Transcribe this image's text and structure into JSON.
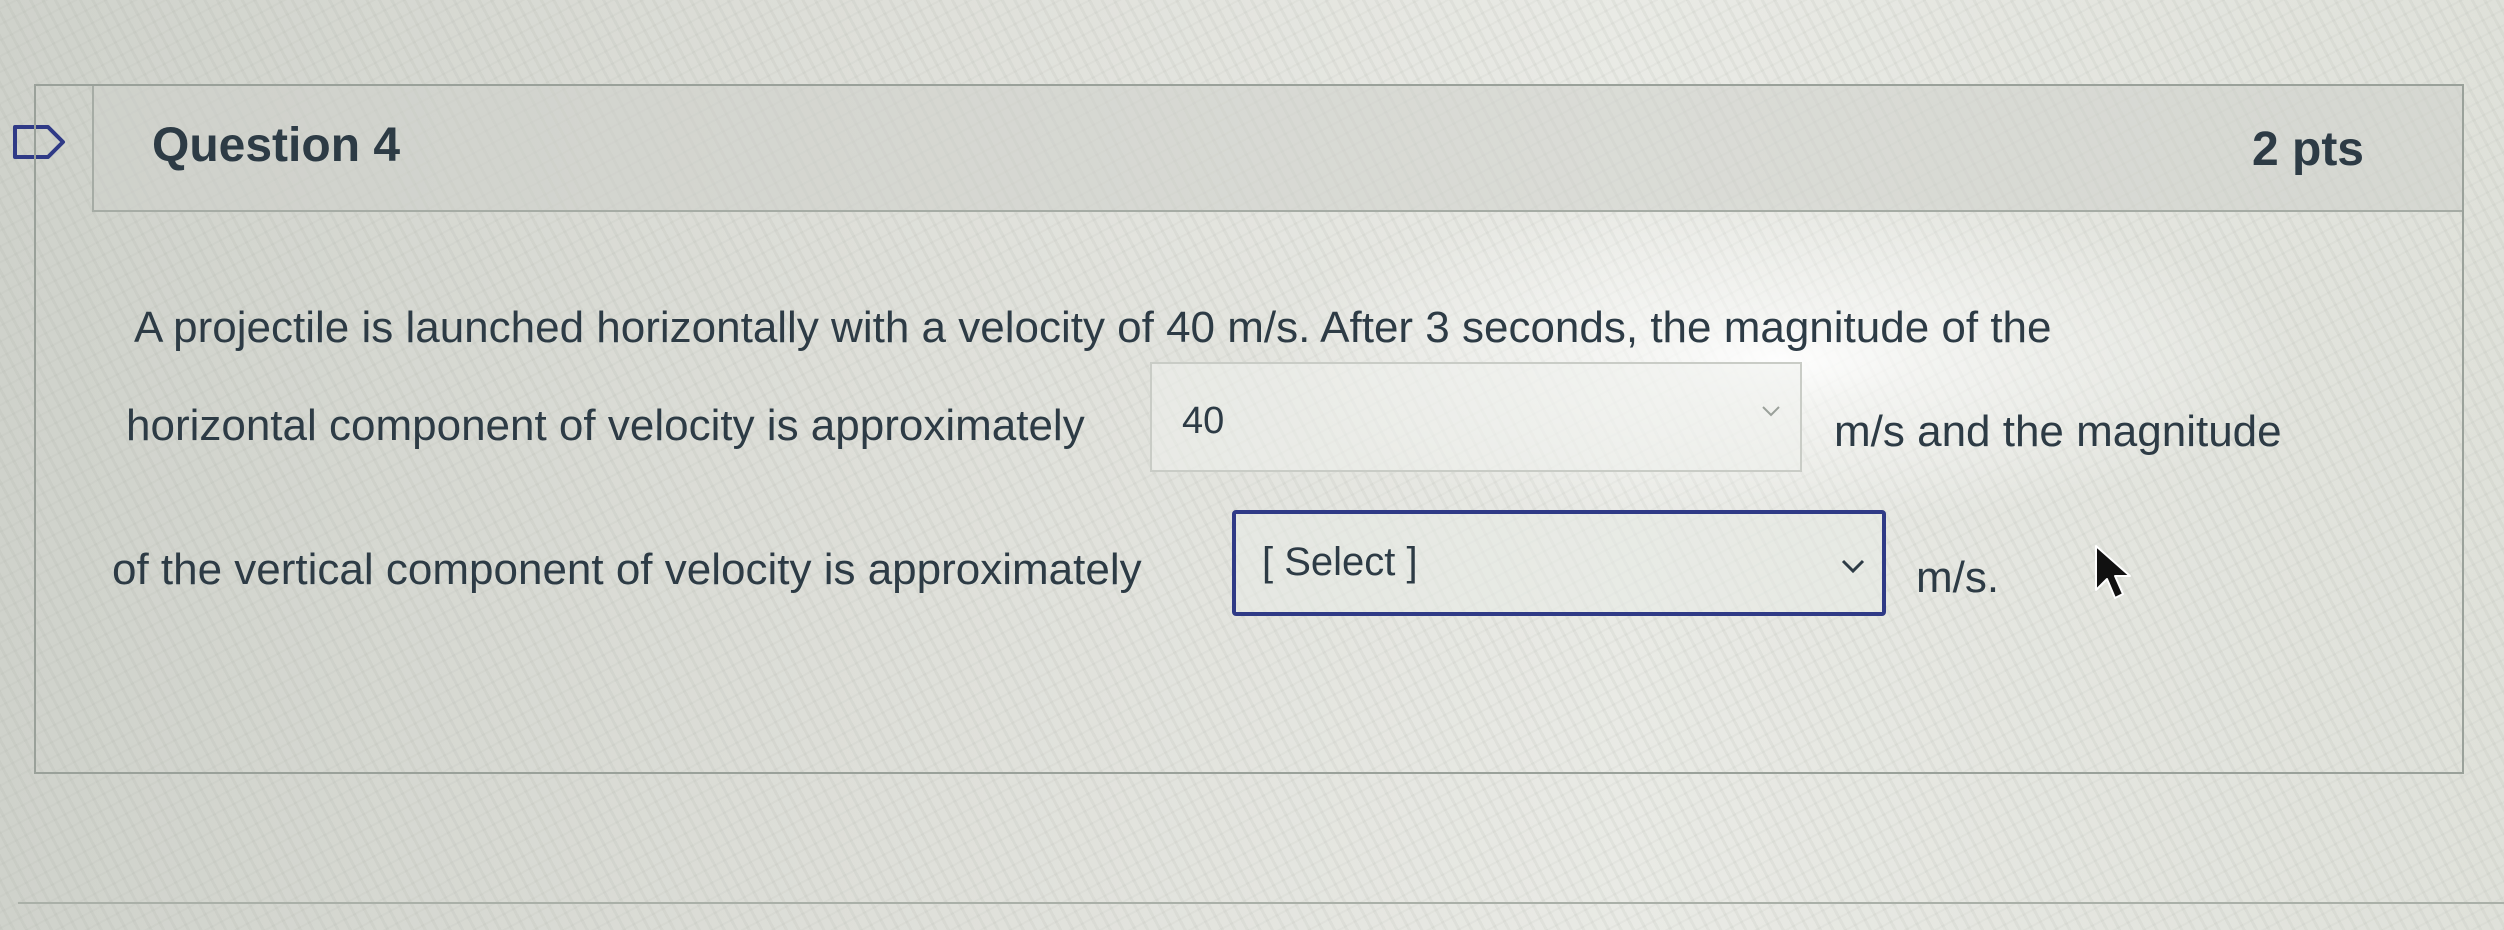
{
  "question": {
    "title": "Question 4",
    "points": "2 pts",
    "text_line1": "A projectile is launched horizontally with a velocity of 40 m/s. After 3 seconds, the magnitude of the",
    "text_line2_before": "horizontal component of velocity is approximately",
    "text_line2_after": "m/s and the magnitude",
    "text_line3_before": "of the vertical component of velocity is approximately",
    "text_line3_after": "m/s."
  },
  "answer_1": {
    "value": "40"
  },
  "answer_2": {
    "selected": "[ Select ]"
  },
  "icons": {
    "bookmark": "bookmark-icon",
    "chevron": "chevron-down-icon",
    "cursor": "mouse-pointer-icon"
  },
  "colors": {
    "text": "#2d3b45",
    "focus_border": "#2f3a86"
  }
}
